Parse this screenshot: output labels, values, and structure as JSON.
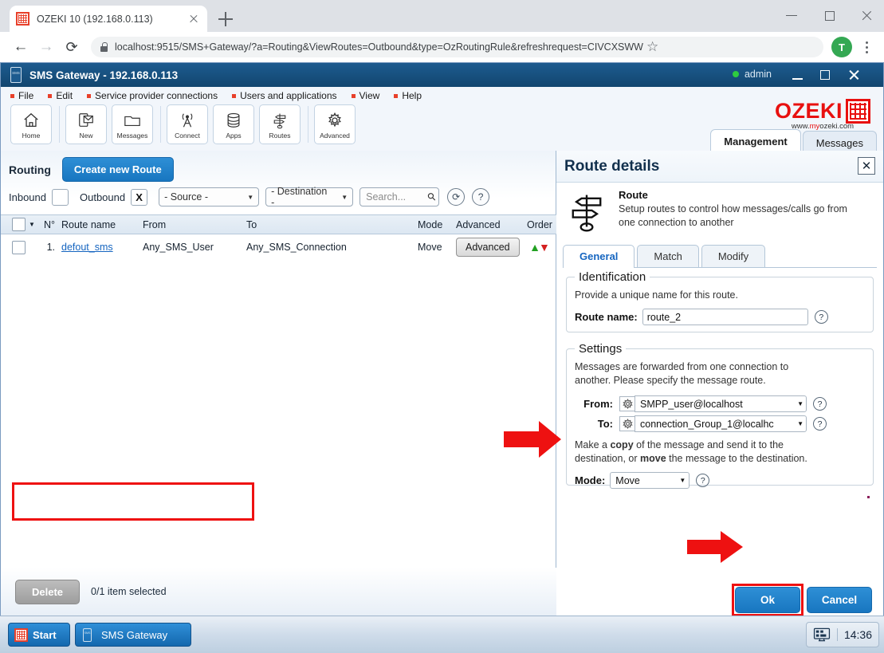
{
  "browser": {
    "tab_title": "OZEKI 10 (192.168.0.113)",
    "url": "localhost:9515/SMS+Gateway/?a=Routing&ViewRoutes=Outbound&type=OzRoutingRule&refreshrequest=CIVCXSWW",
    "profile_initial": "T"
  },
  "app": {
    "title": "SMS Gateway  - 192.168.0.113",
    "user": "admin",
    "menu": [
      "File",
      "Edit",
      "Service provider connections",
      "Users and applications",
      "View",
      "Help"
    ],
    "toolbar": [
      {
        "label": "Home",
        "icon": "home-icon"
      },
      {
        "label": "New",
        "icon": "new-message-icon"
      },
      {
        "label": "Messages",
        "icon": "folder-icon"
      },
      {
        "label": "Connect",
        "icon": "antenna-icon"
      },
      {
        "label": "Apps",
        "icon": "database-icon"
      },
      {
        "label": "Routes",
        "icon": "routes-icon"
      },
      {
        "label": "Advanced",
        "icon": "gear-icon"
      }
    ],
    "logo": {
      "word": "OZEKI",
      "sub_pre": "www.",
      "sub_brand": "my",
      "sub_post": "ozeki.com"
    },
    "top_tabs": [
      {
        "label": "Management",
        "active": true
      },
      {
        "label": "Messages",
        "active": false
      }
    ]
  },
  "routing": {
    "section_label": "Routing",
    "create_button": "Create new Route",
    "filters": {
      "inbound_label": "Inbound",
      "inbound_checked": "",
      "outbound_label": "Outbound",
      "outbound_checked": "X",
      "source_select": "- Source -",
      "destination_select": "- Destination -",
      "search_placeholder": "Search...",
      "refresh_icon": "refresh-icon",
      "help_icon": "help-icon"
    },
    "columns": [
      "N°",
      "Route name",
      "From",
      "To",
      "Mode",
      "Advanced",
      "Order"
    ],
    "rows": [
      {
        "num": "1.",
        "name": "defout_sms",
        "from": "Any_SMS_User",
        "to": "Any_SMS_Connection",
        "mode": "Move",
        "advanced": "Advanced",
        "order_up": "▲",
        "order_down": "▼"
      }
    ],
    "footer": {
      "delete_button": "Delete",
      "selection_status": "0/1 item selected"
    }
  },
  "route_details": {
    "panel_title": "Route details",
    "close_icon": "close-icon",
    "hero": {
      "icon": "routes-icon",
      "heading": "Route",
      "description": "Setup routes to control how messages/calls go from one connection to another"
    },
    "tabs": [
      {
        "label": "General",
        "active": true
      },
      {
        "label": "Match",
        "active": false
      },
      {
        "label": "Modify",
        "active": false
      }
    ],
    "identification": {
      "legend": "Identification",
      "helper": "Provide a unique name for this route.",
      "route_name_label": "Route name:",
      "route_name_value": "route_2"
    },
    "settings": {
      "legend": "Settings",
      "helper": "Messages are forwarded from one connection to another. Please specify the message route.",
      "from_label": "From:",
      "from_value": "SMPP_user@localhost",
      "to_label": "To:",
      "to_value": "connection_Group_1@localhc",
      "mode_helper_pre": "Make a ",
      "mode_helper_b1": "copy",
      "mode_helper_mid": " of the message and send it to the destination, or ",
      "mode_helper_b2": "move",
      "mode_helper_post": " the message to the destination.",
      "mode_label": "Mode:",
      "mode_value": "Move"
    },
    "buttons": {
      "ok": "Ok",
      "cancel": "Cancel"
    }
  },
  "taskbar": {
    "start_label": "Start",
    "task_label": "SMS Gateway",
    "clock": "14:36",
    "tray_icon": "monitor-icon"
  },
  "colors": {
    "accent_blue": "#1876c0",
    "brand_red": "#e8100f",
    "highlight_red": "#ee1111",
    "titlebar_blue": "#12466f",
    "link_blue": "#1565c0",
    "status_green": "#2ecc40"
  }
}
